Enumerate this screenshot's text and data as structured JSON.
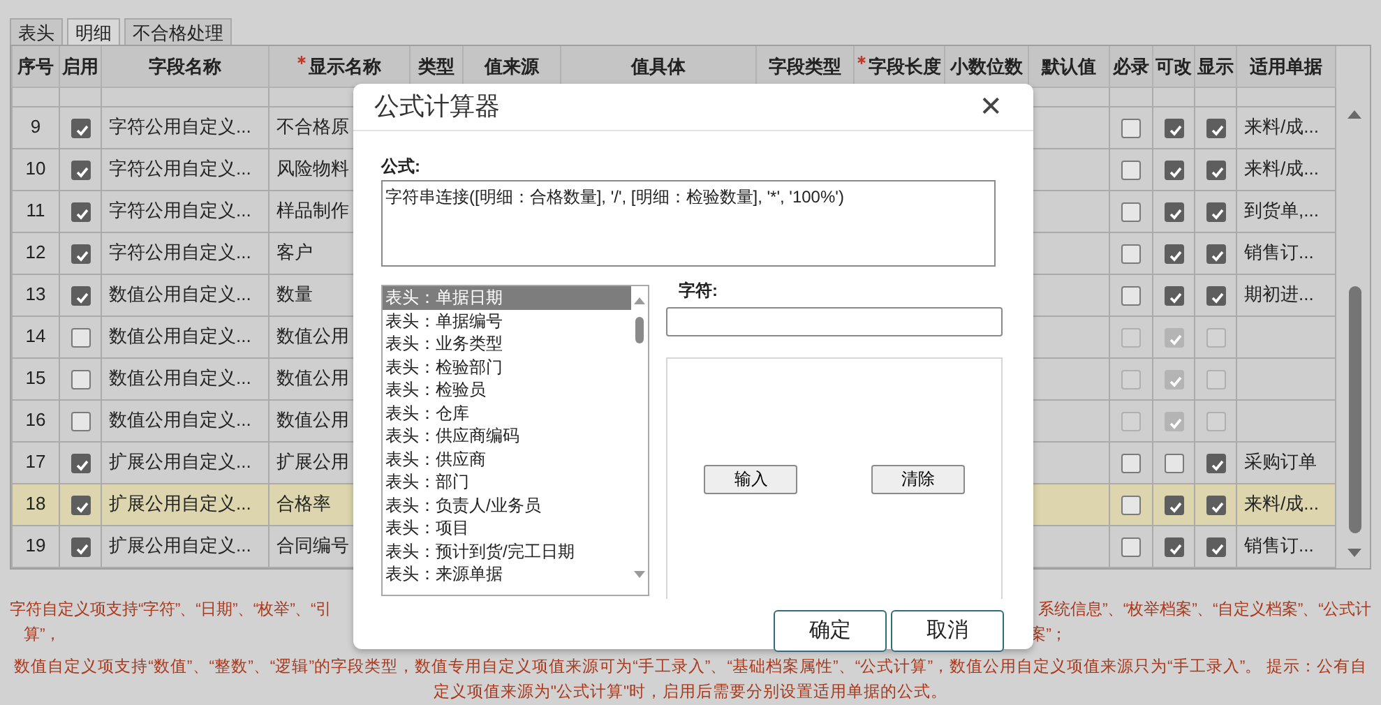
{
  "tabs": [
    {
      "label": "表头",
      "selected": false
    },
    {
      "label": "明细",
      "selected": true
    },
    {
      "label": "不合格处理",
      "selected": false
    }
  ],
  "table": {
    "columns": [
      {
        "label": "序号",
        "required": false
      },
      {
        "label": "启用",
        "required": false
      },
      {
        "label": "字段名称",
        "required": false
      },
      {
        "label": "显示名称",
        "required": true
      },
      {
        "label": "类型",
        "required": false
      },
      {
        "label": "值来源",
        "required": false
      },
      {
        "label": "值具体",
        "required": false
      },
      {
        "label": "字段类型",
        "required": false
      },
      {
        "label": "字段长度",
        "required": true
      },
      {
        "label": "小数位数",
        "required": false
      },
      {
        "label": "默认值",
        "required": false
      },
      {
        "label": "必录",
        "required": false
      },
      {
        "label": "可改",
        "required": false
      },
      {
        "label": "显示",
        "required": false
      },
      {
        "label": "适用单据",
        "required": false
      }
    ],
    "rows": [
      {
        "no": "9",
        "enabled": true,
        "field_name": "字符公用自定义...",
        "display_name": "不合格原",
        "mandatory": false,
        "editable": true,
        "visible": true,
        "flags_disabled": false,
        "documents": "来料/成...",
        "selected": false
      },
      {
        "no": "10",
        "enabled": true,
        "field_name": "字符公用自定义...",
        "display_name": "风险物料",
        "mandatory": false,
        "editable": true,
        "visible": true,
        "flags_disabled": false,
        "documents": "来料/成...",
        "selected": false
      },
      {
        "no": "11",
        "enabled": true,
        "field_name": "字符公用自定义...",
        "display_name": "样品制作",
        "mandatory": false,
        "editable": true,
        "visible": true,
        "flags_disabled": false,
        "documents": "到货单,...",
        "selected": false
      },
      {
        "no": "12",
        "enabled": true,
        "field_name": "字符公用自定义...",
        "display_name": "客户",
        "mandatory": false,
        "editable": true,
        "visible": true,
        "flags_disabled": false,
        "documents": "销售订...",
        "selected": false
      },
      {
        "no": "13",
        "enabled": true,
        "field_name": "数值公用自定义...",
        "display_name": "数量",
        "mandatory": false,
        "editable": true,
        "visible": true,
        "flags_disabled": false,
        "documents": "期初进...",
        "selected": false
      },
      {
        "no": "14",
        "enabled": false,
        "field_name": "数值公用自定义...",
        "display_name": "数值公用",
        "mandatory": false,
        "editable": true,
        "visible": false,
        "flags_disabled": true,
        "selected": false
      },
      {
        "no": "15",
        "enabled": false,
        "field_name": "数值公用自定义...",
        "display_name": "数值公用",
        "mandatory": false,
        "editable": true,
        "visible": false,
        "flags_disabled": true,
        "selected": false
      },
      {
        "no": "16",
        "enabled": false,
        "field_name": "数值公用自定义...",
        "display_name": "数值公用",
        "mandatory": false,
        "editable": true,
        "visible": false,
        "flags_disabled": true,
        "selected": false
      },
      {
        "no": "17",
        "enabled": true,
        "field_name": "扩展公用自定义...",
        "display_name": "扩展公用",
        "mandatory": false,
        "editable": false,
        "visible": true,
        "flags_disabled": false,
        "documents": "采购订单",
        "selected": false
      },
      {
        "no": "18",
        "enabled": true,
        "field_name": "扩展公用自定义...",
        "display_name": "合格率",
        "mandatory": false,
        "editable": true,
        "visible": true,
        "flags_disabled": false,
        "documents": "来料/成...",
        "selected": true
      },
      {
        "no": "19",
        "enabled": true,
        "field_name": "扩展公用自定义...",
        "display_name": "合同编号",
        "mandatory": false,
        "editable": true,
        "visible": true,
        "flags_disabled": false,
        "documents": "销售订...",
        "selected": false
      }
    ]
  },
  "notes": [
    {
      "segments": [
        "字符自定义项支持“字符”、“日期”、“枚举”、“引",
        "系统信息”、“枚举档案”、“自定义档案”、“公式计"
      ]
    },
    {
      "segments": [
        "算”，",
        "案”；"
      ]
    },
    {
      "segments": [
        "数值自定义项支持“数值”、“整数”、“逻辑”的字段类型，数值专用自定义项值来源可为“手工录入”、“基础档案属性”、“公式计算”，数值公用自定义项值来源只为“手工录入”。 提示：公有自"
      ]
    },
    {
      "segments": [
        "定义项值来源为\"公式计算\"时，启用后需要分别设置适用单据的公式。"
      ]
    }
  ],
  "dialog": {
    "title": "公式计算器",
    "close": "✕",
    "formula_label": "公式:",
    "formula": "字符串连接([明细：合格数量], '/', [明细：检验数量], '*', '100%')",
    "fields": [
      {
        "label": "表头：单据日期",
        "selected": true
      },
      {
        "label": "表头：单据编号",
        "selected": false
      },
      {
        "label": "表头：业务类型",
        "selected": false
      },
      {
        "label": "表头：检验部门",
        "selected": false
      },
      {
        "label": "表头：检验员",
        "selected": false
      },
      {
        "label": "表头：仓库",
        "selected": false
      },
      {
        "label": "表头：供应商编码",
        "selected": false
      },
      {
        "label": "表头：供应商",
        "selected": false
      },
      {
        "label": "表头：部门",
        "selected": false
      },
      {
        "label": "表头：负责人/业务员",
        "selected": false
      },
      {
        "label": "表头：项目",
        "selected": false
      },
      {
        "label": "表头：预计到货/完工日期",
        "selected": false
      },
      {
        "label": "表头：来源单据",
        "selected": false
      }
    ],
    "char_label": "字符:",
    "panel_buttons": [
      "输入",
      "清除"
    ],
    "buttons": [
      "确定",
      "取消"
    ]
  }
}
